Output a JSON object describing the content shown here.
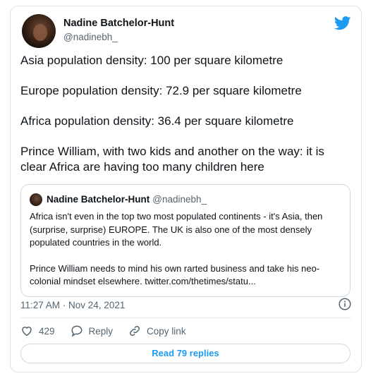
{
  "colors": {
    "accent": "#1d9bf0",
    "text_primary": "#0f1419",
    "text_secondary": "#536471",
    "border": "#cfd9de"
  },
  "tweet": {
    "author": {
      "display_name": "Nadine Batchelor-Hunt",
      "handle": "@nadinebh_"
    },
    "paragraphs": [
      "Asia population density: 100 per square kilometre",
      "Europe population density: 72.9 per square kilometre",
      "Africa population density: 36.4 per square kilometre",
      "Prince William, with two kids and another on the way: it is clear Africa are having too many children here"
    ],
    "quoted": {
      "display_name": "Nadine Batchelor-Hunt",
      "handle": "@nadinebh_",
      "paragraphs": [
        "Africa isn't even in the top two most populated continents - it's Asia, then (surprise, surprise) EUROPE. The UK is also one of the most densely populated countries in the world.",
        "Prince William needs to mind his own rarted business and take his neo-colonial mindset elsewhere. twitter.com/thetimes/statu..."
      ]
    },
    "timestamp": "11:27 AM · Nov 24, 2021",
    "like_count": "429",
    "reply_label": "Reply",
    "copy_link_label": "Copy link",
    "read_replies_label": "Read 79 replies"
  },
  "icons": {
    "brand": "twitter-bird-icon",
    "info": "info-icon",
    "like": "heart-icon",
    "reply": "speech-bubble-icon",
    "copy": "link-icon"
  }
}
